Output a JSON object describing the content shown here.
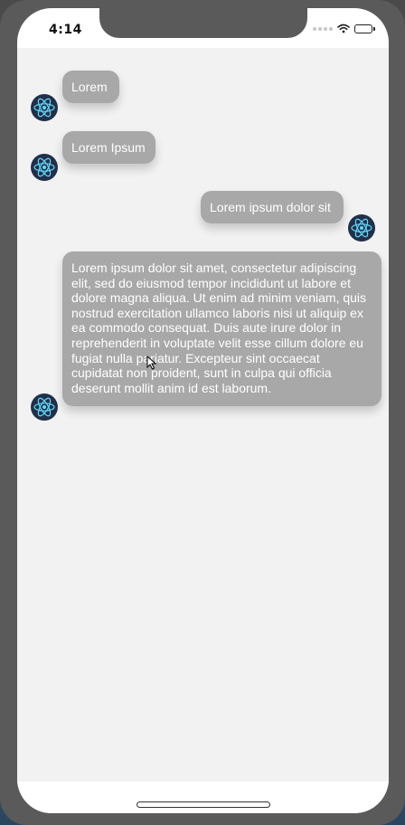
{
  "status_bar": {
    "time": "4:14"
  },
  "messages": [
    {
      "side": "left",
      "text": "Lorem",
      "avatar_icon": "react-atom-icon"
    },
    {
      "side": "left",
      "text": "Lorem Ipsum",
      "avatar_icon": "react-atom-icon"
    },
    {
      "side": "right",
      "text": "Lorem ipsum dolor sit",
      "avatar_icon": "react-atom-icon"
    },
    {
      "side": "left",
      "text": "Lorem ipsum dolor sit amet, consectetur adipiscing elit, sed do eiusmod tempor incididunt ut labore et dolore magna aliqua. Ut enim ad minim veniam, quis nostrud exercitation ullamco laboris nisi ut aliquip ex ea commodo consequat. Duis aute irure dolor in reprehenderit in voluptate velit esse cillum dolore eu fugiat nulla pariatur. Excepteur sint occaecat cupidatat non proident, sunt in culpa qui officia deserunt mollit anim id est laborum.",
      "avatar_icon": "react-atom-icon"
    }
  ],
  "colors": {
    "bubble": "#a8a8a8",
    "bubble_text": "#ffffff",
    "chat_background": "#f2f2f2",
    "avatar_background": "#22304a",
    "avatar_icon": "#61dafb"
  }
}
